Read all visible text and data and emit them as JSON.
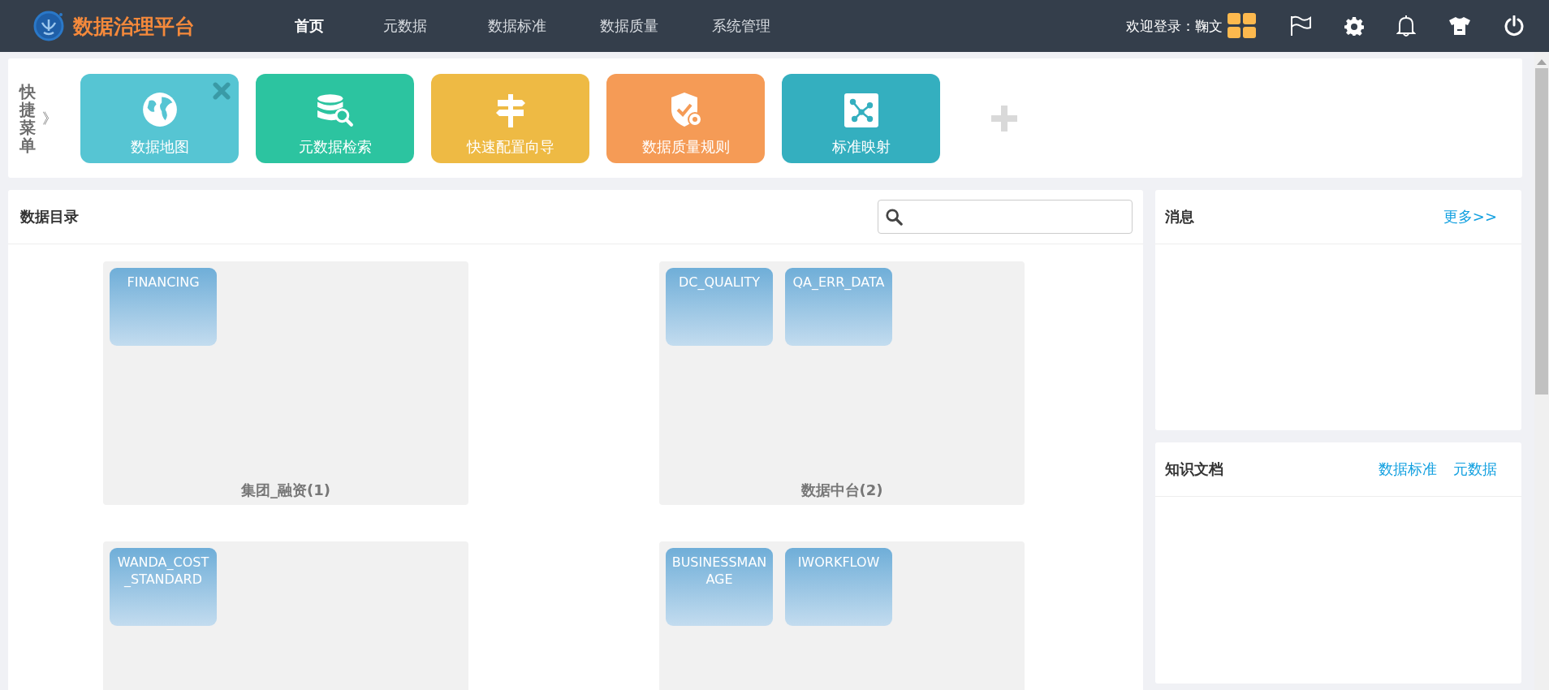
{
  "header": {
    "brand": "数据治理平台",
    "nav": [
      {
        "label": "首页",
        "selected": true
      },
      {
        "label": "元数据",
        "selected": false
      },
      {
        "label": "数据标准",
        "selected": false
      },
      {
        "label": "数据质量",
        "selected": false
      },
      {
        "label": "系统管理",
        "selected": false
      }
    ],
    "welcome": "欢迎登录：",
    "user": "鞠文"
  },
  "quick_menu": {
    "title": "快捷菜单",
    "toggle": "》",
    "tiles": [
      {
        "label": "数据地图",
        "kind": "globe",
        "color": "#56c5d3",
        "removable": true
      },
      {
        "label": "元数据检索",
        "kind": "database",
        "color": "#2cc4a0",
        "removable": false
      },
      {
        "label": "快速配置向导",
        "kind": "signpost",
        "color": "#eeba44",
        "removable": false
      },
      {
        "label": "数据质量规则",
        "kind": "shield",
        "color": "#f59b56",
        "removable": false
      },
      {
        "label": "标准映射",
        "kind": "nodes",
        "color": "#34afbf",
        "removable": false
      }
    ]
  },
  "catalog": {
    "title": "数据目录",
    "groups": [
      {
        "label": "集团_融资(1)",
        "items": [
          "FINANCING"
        ]
      },
      {
        "label": "数据中台(2)",
        "items": [
          "DC_QUALITY",
          "QA_ERR_DATA"
        ]
      },
      {
        "items": [
          "WANDA_COST_STANDARD"
        ]
      },
      {
        "items": [
          "BUSINESSMANAGE",
          "IWORKFLOW"
        ]
      }
    ]
  },
  "messages": {
    "title": "消息",
    "more": "更多>>"
  },
  "documents": {
    "title": "知识文档",
    "links": [
      "数据标准",
      "元数据"
    ]
  }
}
